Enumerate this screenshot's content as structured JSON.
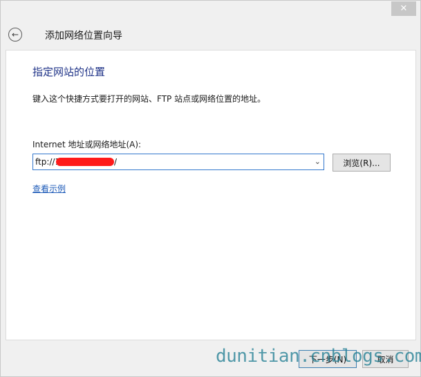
{
  "window": {
    "close_label": "✕"
  },
  "header": {
    "back_icon": "back-arrow-icon",
    "title": "添加网络位置向导"
  },
  "main": {
    "heading": "指定网站的位置",
    "description": "键入这个快捷方式要打开的网站、FTP 站点或网络位置的地址。",
    "address_label": "Internet 地址或网络地址(A):",
    "address_prefix": "ftp://1",
    "address_suffix": "/",
    "browse_label": "浏览(R)...",
    "example_link": "查看示例"
  },
  "footer": {
    "next_label": "下一步(N)",
    "cancel_label": "取消"
  },
  "watermark": "dunitian.cnblogs.com",
  "colors": {
    "heading": "#1e3287",
    "link": "#1e5bb8",
    "focus_border": "#3377cc",
    "redaction": "#ff1a1a"
  }
}
